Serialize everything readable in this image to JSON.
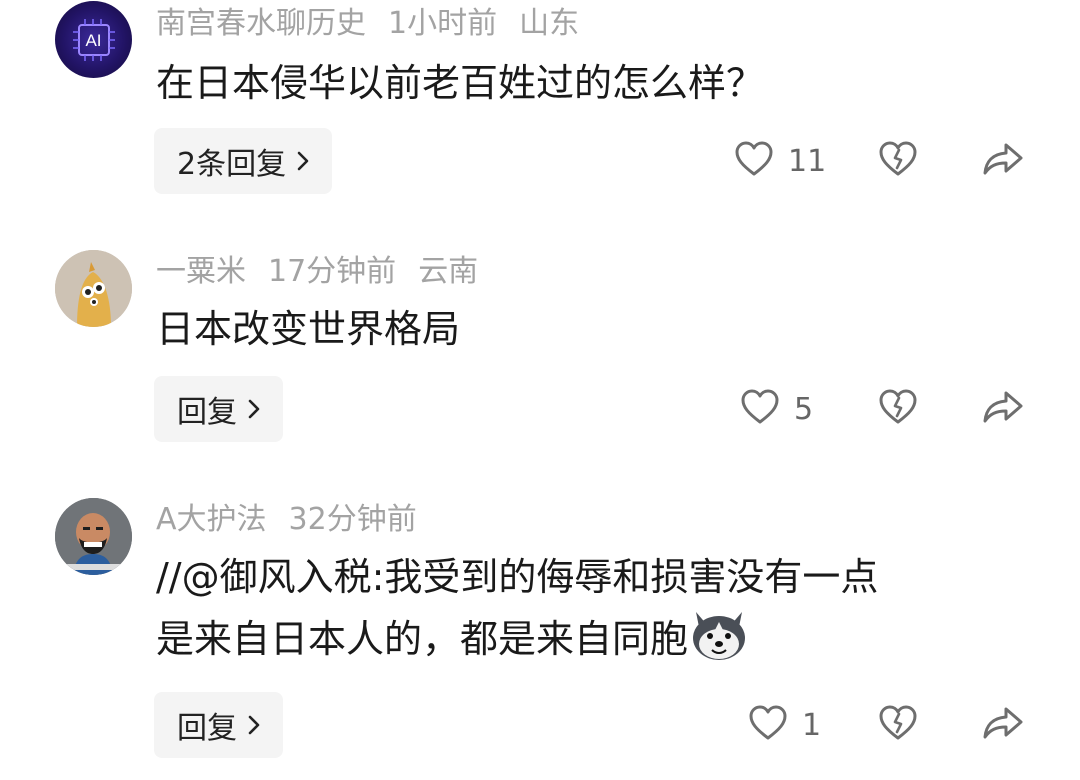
{
  "comments": [
    {
      "author": "南宫春水聊历史",
      "time": "1小时前",
      "location": "山东",
      "text": "在日本侵华以前老百姓过的怎么样？",
      "reply_label": "2条回复",
      "likes": "11",
      "avatar_icon": "ai-chip-avatar",
      "avatar_text": "AI"
    },
    {
      "author": "一粟米",
      "time": "17分钟前",
      "location": "云南",
      "text": "日本改变世界格局",
      "reply_label": "回复",
      "likes": "5",
      "avatar_icon": "cartoon-creature-avatar"
    },
    {
      "author": "A大护法",
      "time": "32分钟前",
      "location": "",
      "text_line1": "//@御风入税:我受到的侮辱和损害没有一点",
      "text_line2": "是来自日本人的，都是来自同胞",
      "reply_label": "回复",
      "likes": "1",
      "avatar_icon": "cartoon-man-avatar",
      "emoji": "husky-dog-emoji"
    }
  ],
  "colors": {
    "meta": "#a3a3a3",
    "text": "#1a1a1a",
    "reply_bg": "#f4f4f4",
    "icon": "#7a7a7a"
  }
}
